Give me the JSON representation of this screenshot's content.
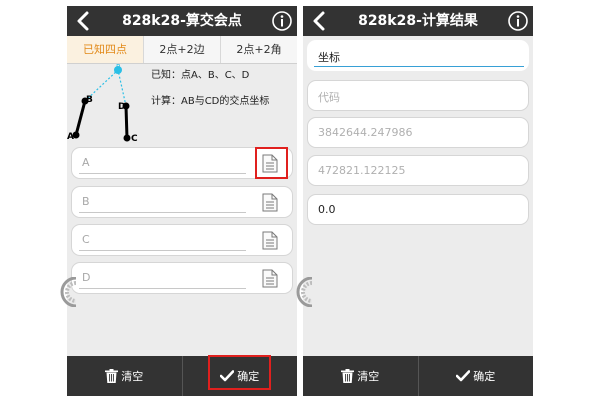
{
  "left_screen": {
    "title": "828k28-算交会点",
    "tabs": [
      {
        "label": "已知四点",
        "active": true
      },
      {
        "label": "2点+2边",
        "active": false
      },
      {
        "label": "2点+2角",
        "active": false
      }
    ],
    "diagram": {
      "points": [
        "P",
        "B",
        "D",
        "A",
        "C"
      ],
      "colors": {
        "known_points": "#000000",
        "result_point": "#2bbfe6"
      }
    },
    "known_text": "已知：点A、B、C、D",
    "calc_text": "计算：AB与CD的交点坐标",
    "fields": [
      {
        "placeholder": "A",
        "icon": "document-icon"
      },
      {
        "placeholder": "B",
        "icon": "document-icon"
      },
      {
        "placeholder": "C",
        "icon": "document-icon"
      },
      {
        "placeholder": "D",
        "icon": "document-icon"
      }
    ],
    "bottom": {
      "clear_label": "清空",
      "confirm_label": "确定"
    }
  },
  "right_screen": {
    "title": "828k28-计算结果",
    "fields": [
      {
        "value": "坐标",
        "style": "focused"
      },
      {
        "value": "代码",
        "style": "placeholder"
      },
      {
        "value": "3842644.247986",
        "style": "placeholder"
      },
      {
        "value": "472821.122125",
        "style": "placeholder"
      },
      {
        "value": "0.0",
        "style": "value"
      }
    ],
    "bottom": {
      "clear_label": "清空",
      "confirm_label": "确定"
    }
  },
  "colors": {
    "titlebar": "#333333",
    "active_tab_text": "#e28a1a",
    "highlight_box": "#e0201e",
    "focus_line": "#37a0d6"
  }
}
